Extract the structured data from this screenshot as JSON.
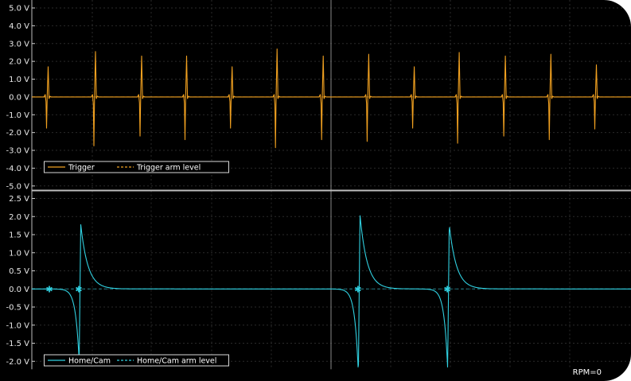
{
  "chart_data": [
    {
      "type": "line",
      "ylabel": "",
      "xlabel": "",
      "ylim": [
        -5.0,
        5.0
      ],
      "yticks": [
        "5.0 V",
        "4.0 V",
        "3.0 V",
        "2.0 V",
        "1.0 V",
        "0.0 V",
        "-1.0 V",
        "-2.0 V",
        "-3.0 V",
        "-4.0 V",
        "-5.0 V"
      ],
      "xlim": [
        0,
        100
      ],
      "grid": true,
      "legend_position": "bottom-left",
      "series": [
        {
          "name": "Trigger",
          "color": "#f0a020",
          "style": "solid",
          "pulses": [
            {
              "x": 2.7,
              "peak": 1.7,
              "trough": -1.75
            },
            {
              "x": 10.6,
              "peak": 2.55,
              "trough": -2.75
            },
            {
              "x": 18.3,
              "peak": 2.3,
              "trough": -2.2
            },
            {
              "x": 25.8,
              "peak": 2.3,
              "trough": -2.4
            },
            {
              "x": 33.4,
              "peak": 1.7,
              "trough": -1.75
            },
            {
              "x": 40.9,
              "peak": 2.7,
              "trough": -2.85
            },
            {
              "x": 48.6,
              "peak": 2.3,
              "trough": -2.4
            },
            {
              "x": 56.2,
              "peak": 2.4,
              "trough": -2.5
            },
            {
              "x": 63.8,
              "peak": 1.7,
              "trough": -1.75
            },
            {
              "x": 71.3,
              "peak": 2.5,
              "trough": -2.6
            },
            {
              "x": 79.0,
              "peak": 2.3,
              "trough": -2.2
            },
            {
              "x": 86.6,
              "peak": 2.4,
              "trough": -2.4
            },
            {
              "x": 94.2,
              "peak": 1.8,
              "trough": -1.8
            }
          ]
        },
        {
          "name": "Trigger arm level",
          "color": "#f0a020",
          "style": "dashed",
          "level": 0.0
        }
      ]
    },
    {
      "type": "line",
      "ylabel": "",
      "xlabel": "",
      "ylim": [
        -0.5,
        2.5
      ],
      "yticks": [
        "2.5 V",
        "2.0 V",
        "1.5 V",
        "1.0 V",
        "0.5 V",
        "0.0 V",
        "-0.5 V",
        "-1.0 V",
        "-1.5 V",
        "-2.0 V"
      ],
      "xlim": [
        0,
        100
      ],
      "grid": true,
      "legend_position": "bottom-left",
      "series": [
        {
          "name": "Home/Cam",
          "color": "#30d0e0",
          "style": "solid",
          "pulses": [
            {
              "x": 7.9,
              "peak": 1.78,
              "trough": -2.0
            },
            {
              "x": 54.5,
              "peak": 2.05,
              "trough": -2.35
            },
            {
              "x": 69.4,
              "peak": 1.78,
              "trough": -2.2
            }
          ]
        },
        {
          "name": "Home/Cam arm level",
          "color": "#30d0e0",
          "style": "dashed",
          "level": 0.0
        }
      ]
    }
  ],
  "status": {
    "rpm_label": "RPM=0"
  }
}
